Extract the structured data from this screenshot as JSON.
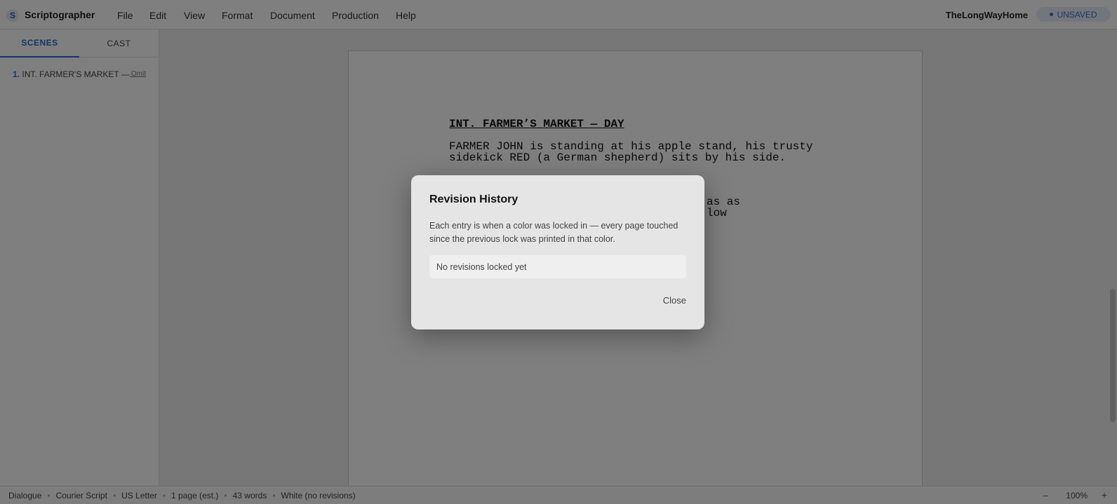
{
  "app": {
    "logo_letter": "S",
    "title": "Scriptographer",
    "document_name": "TheLongWayHome",
    "save_status": "UNSAVED"
  },
  "menu": [
    "File",
    "Edit",
    "View",
    "Format",
    "Document",
    "Production",
    "Help"
  ],
  "sidebar": {
    "tabs": [
      "SCENES",
      "CAST"
    ],
    "active_tab": "SCENES",
    "scenes": [
      {
        "number": "1.",
        "label": "INT. FARMER'S MARKET —...",
        "omit_label": "Omit"
      }
    ]
  },
  "script": {
    "scene_heading": "INT. FARMER’S MARKET — DAY",
    "action_1": "FARMER JOHN is standing at his apple stand, his trusty\nsidekick RED (a German shepherd) sits by his side.",
    "action_2_partial": "as as\nlow"
  },
  "statusbar": {
    "items": [
      "Dialogue",
      "Courier Script",
      "US Letter",
      "1 page (est.)",
      "43 words",
      "White (no revisions)"
    ],
    "separator": "•",
    "zoom_out": "–",
    "zoom": "100%",
    "zoom_in": "+"
  },
  "modal": {
    "title": "Revision History",
    "description": "Each entry is when a color was locked in — every page touched since the previous lock was printed in that color.",
    "empty_text": "No revisions locked yet",
    "close_label": "Close"
  },
  "colors": {
    "accent": "#2b6ad0",
    "overlay": "rgba(0,0,0,0.5)",
    "modal_bg": "#e5e5e5"
  }
}
